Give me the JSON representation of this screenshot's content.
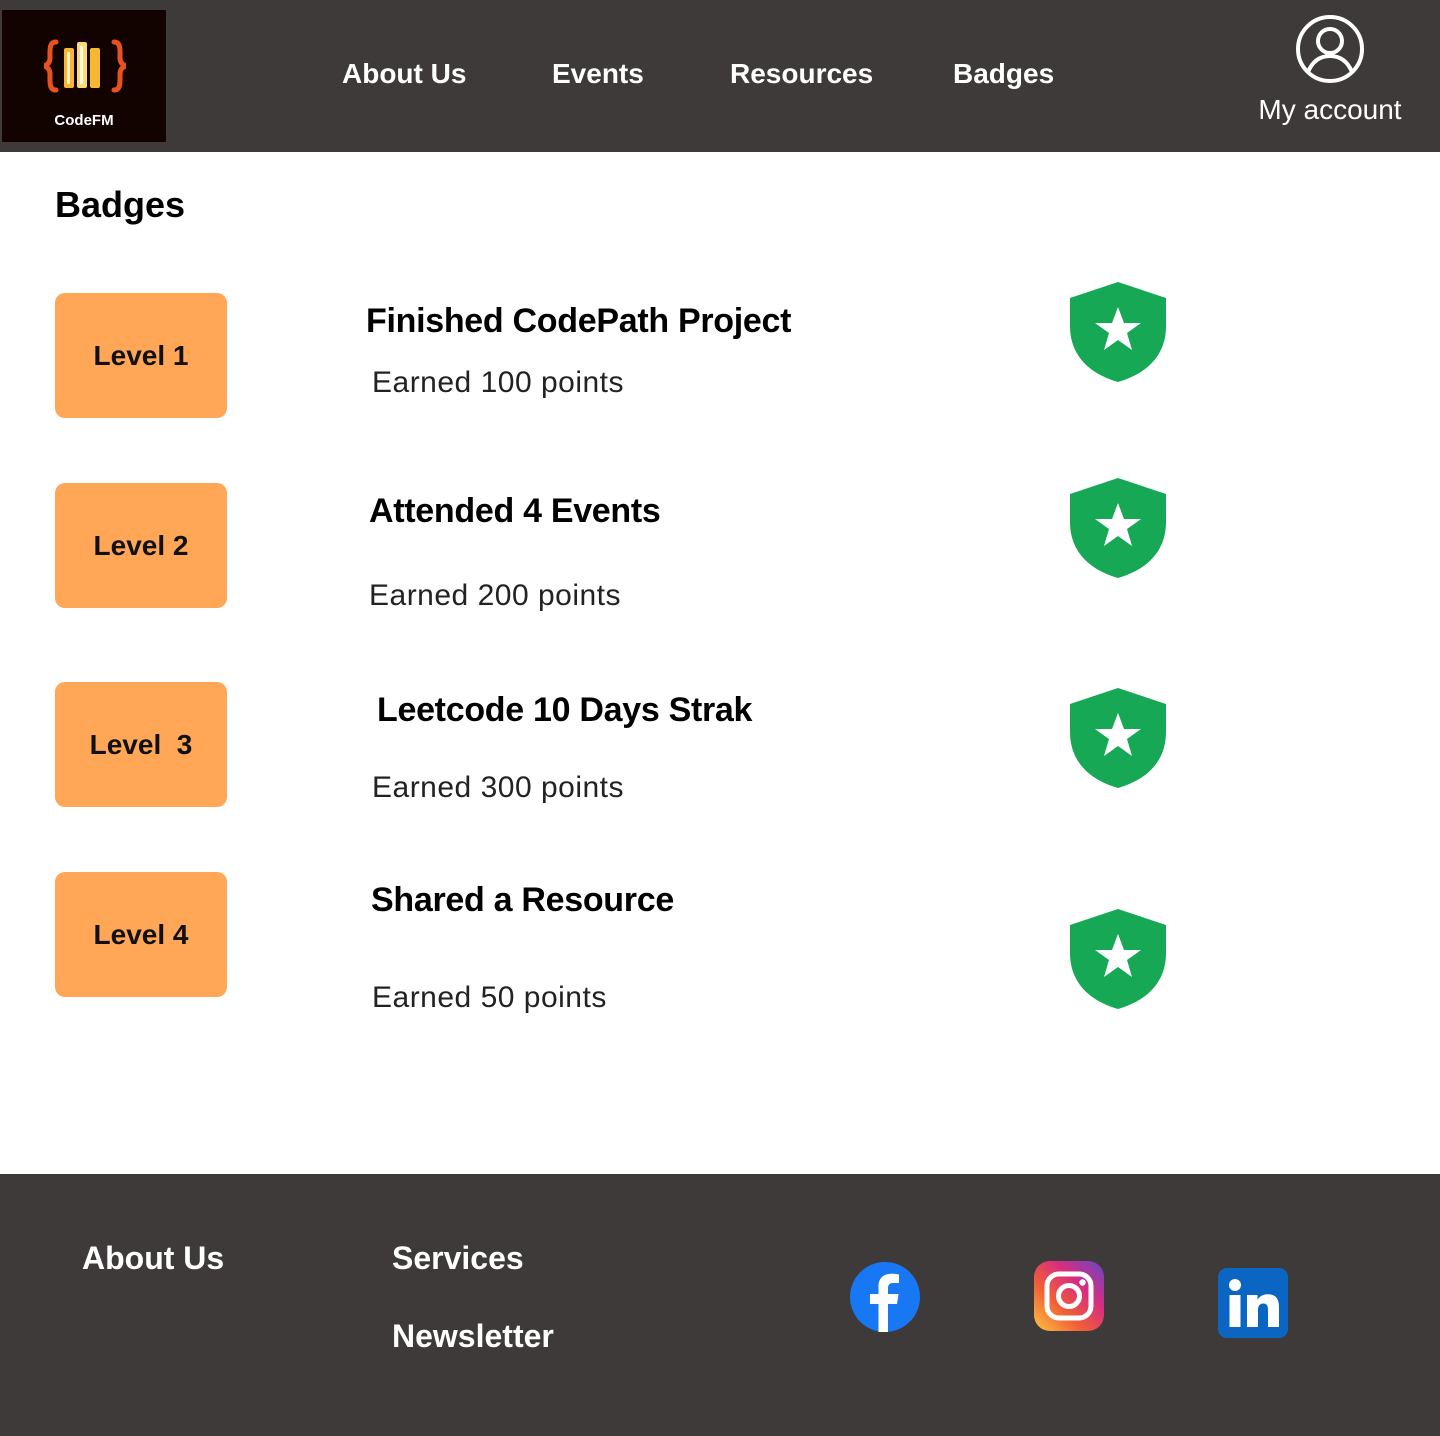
{
  "colors": {
    "header_bg": "#3e3a39",
    "logo_bg": "#120200",
    "level_bg": "#ffa657",
    "shield_green": "#16a855",
    "facebook_blue": "#1877f2",
    "linkedin_blue": "#0a66c2"
  },
  "header": {
    "logo": {
      "text": "CodeFM",
      "icon": "code-books-icon"
    },
    "nav": [
      "About Us",
      "Events",
      "Resources",
      "Badges"
    ],
    "account": {
      "label": "My account",
      "icon": "user-circle-icon"
    }
  },
  "main": {
    "title": "Badges",
    "badges": [
      {
        "level": "Level 1",
        "title": "Finished CodePath Project",
        "points": "Earned 100 points",
        "icon": "shield-star-icon"
      },
      {
        "level": "Level 2",
        "title": "Attended 4 Events",
        "points": "Earned 200 points",
        "icon": "shield-star-icon"
      },
      {
        "level": "Level  3",
        "title": "Leetcode 10 Days Strak",
        "points": "Earned 300 points",
        "icon": "shield-star-icon"
      },
      {
        "level": "Level 4",
        "title": "Shared a Resource",
        "points": "Earned 50 points",
        "icon": "shield-star-icon"
      }
    ]
  },
  "footer": {
    "about": "About Us",
    "services": "Services",
    "newsletter": "Newsletter",
    "social": [
      "facebook-icon",
      "instagram-icon",
      "linkedin-icon"
    ]
  }
}
